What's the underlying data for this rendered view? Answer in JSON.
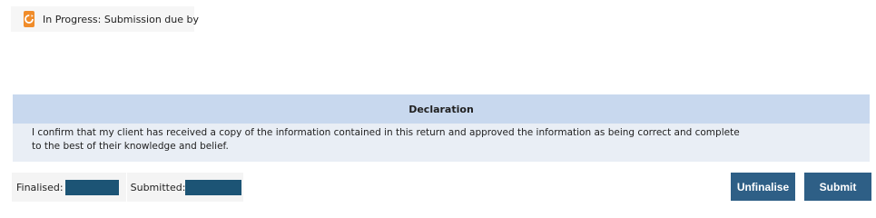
{
  "status": {
    "icon": "in-progress-icon",
    "text": "In Progress: Submission due by",
    "icon_color": "#f08c2a"
  },
  "declaration": {
    "title": "Declaration",
    "line1": "I confirm that my client has received a copy of the information contained in this return and approved the information as being correct and complete",
    "line2": "to the best of their knowledge and belief."
  },
  "footer": {
    "finalised_label": "Finalised:",
    "submitted_label": "Submitted:"
  },
  "actions": {
    "unfinalise_label": "Unfinalise",
    "submit_label": "Submit"
  },
  "colors": {
    "button": "#2e5f86",
    "declaration_header": "#c8d8ee",
    "declaration_body": "#e9eef5"
  }
}
